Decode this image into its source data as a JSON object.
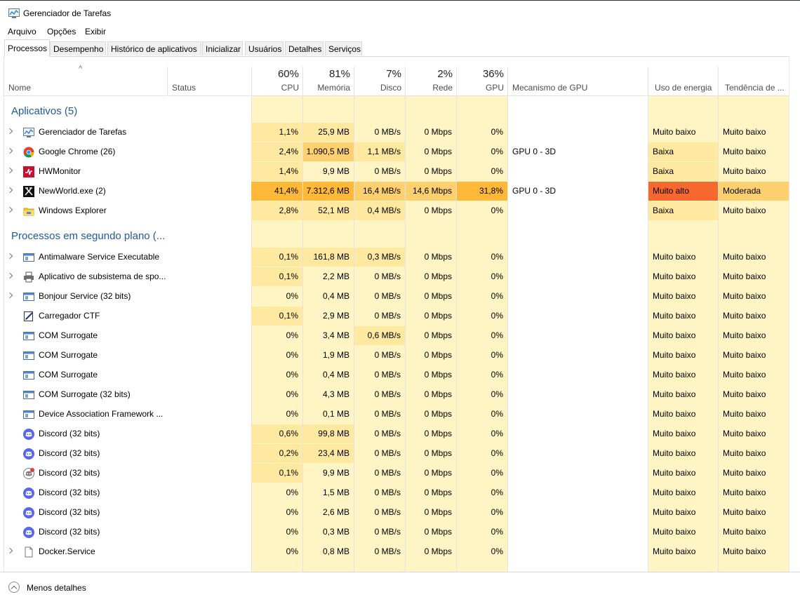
{
  "window": {
    "title": "Gerenciador de Tarefas"
  },
  "menu": [
    "Arquivo",
    "Opções",
    "Exibir"
  ],
  "tabs": [
    "Processos",
    "Desempenho",
    "Histórico de aplicativos",
    "Inicializar",
    "Usuários",
    "Detalhes",
    "Serviços"
  ],
  "active_tab": "Processos",
  "header": {
    "sort_indicator": "^",
    "name": "Nome",
    "status": "Status",
    "cpu": {
      "pct": "60%",
      "label": "CPU"
    },
    "mem": {
      "pct": "81%",
      "label": "Memória"
    },
    "disk": {
      "pct": "7%",
      "label": "Disco"
    },
    "net": {
      "pct": "2%",
      "label": "Rede"
    },
    "gpu": {
      "pct": "36%",
      "label": "GPU"
    },
    "gpu_engine": "Mecanismo de GPU",
    "power": "Uso de energia",
    "power_trend": "Tendência de ..."
  },
  "colors": {
    "light": "#fff4c4",
    "mid": "#ffe8a0",
    "strong": "#ffd070",
    "hot": "#ffb838",
    "veryhigh": "#f7682f",
    "group_text": "#1e5aa0"
  },
  "groups": {
    "apps": "Aplicativos (5)",
    "background": "Processos em segundo plano (..."
  },
  "apps": [
    {
      "name": "Gerenciador de Tarefas",
      "icon": "task-manager-icon",
      "expand": true,
      "cpu": "1,1%",
      "mem": "25,9 MB",
      "disk": "0 MB/s",
      "net": "0 Mbps",
      "gpu": "0%",
      "engine": "",
      "power": "Muito baixo",
      "trend": "Muito baixo"
    },
    {
      "name": "Google Chrome (26)",
      "icon": "chrome-icon",
      "expand": true,
      "cpu": "2,4%",
      "mem": "1.090,5 MB",
      "disk": "1,1 MB/s",
      "net": "0 Mbps",
      "gpu": "0%",
      "engine": "GPU 0 - 3D",
      "power": "Baixa",
      "trend": "Muito baixo"
    },
    {
      "name": "HWMonitor",
      "icon": "hwmonitor-icon",
      "expand": true,
      "cpu": "1,4%",
      "mem": "9,9 MB",
      "disk": "0 MB/s",
      "net": "0 Mbps",
      "gpu": "0%",
      "engine": "",
      "power": "Baixa",
      "trend": "Muito baixo"
    },
    {
      "name": "NewWorld.exe (2)",
      "icon": "newworld-icon",
      "expand": true,
      "cpu": "41,4%",
      "mem": "7.312,6 MB",
      "disk": "16,4 MB/s",
      "net": "14,6 Mbps",
      "gpu": "31,8%",
      "engine": "GPU 0 - 3D",
      "power": "Muito alto",
      "trend": "Moderada"
    },
    {
      "name": "Windows Explorer",
      "icon": "explorer-icon",
      "expand": true,
      "cpu": "2,8%",
      "mem": "52,1 MB",
      "disk": "0,4 MB/s",
      "net": "0 Mbps",
      "gpu": "0%",
      "engine": "",
      "power": "Baixa",
      "trend": "Muito baixo"
    }
  ],
  "background": [
    {
      "name": "Antimalware Service Executable",
      "icon": "service-window-icon",
      "expand": true,
      "cpu": "0,1%",
      "mem": "161,8 MB",
      "disk": "0,3 MB/s",
      "net": "0 Mbps",
      "gpu": "0%",
      "power": "Muito baixo",
      "trend": "Muito baixo"
    },
    {
      "name": "Aplicativo de subsistema de spo...",
      "icon": "printer-icon",
      "expand": true,
      "cpu": "0,1%",
      "mem": "2,2 MB",
      "disk": "0 MB/s",
      "net": "0 Mbps",
      "gpu": "0%",
      "power": "Muito baixo",
      "trend": "Muito baixo"
    },
    {
      "name": "Bonjour Service (32 bits)",
      "icon": "service-window-icon",
      "expand": true,
      "cpu": "0%",
      "mem": "0,4 MB",
      "disk": "0 MB/s",
      "net": "0 Mbps",
      "gpu": "0%",
      "power": "Muito baixo",
      "trend": "Muito baixo"
    },
    {
      "name": "Carregador CTF",
      "icon": "ctf-icon",
      "expand": false,
      "cpu": "0,1%",
      "mem": "2,9 MB",
      "disk": "0 MB/s",
      "net": "0 Mbps",
      "gpu": "0%",
      "power": "Muito baixo",
      "trend": "Muito baixo"
    },
    {
      "name": "COM Surrogate",
      "icon": "service-window-icon",
      "expand": false,
      "cpu": "0%",
      "mem": "3,4 MB",
      "disk": "0,6 MB/s",
      "net": "0 Mbps",
      "gpu": "0%",
      "power": "Muito baixo",
      "trend": "Muito baixo"
    },
    {
      "name": "COM Surrogate",
      "icon": "service-window-icon",
      "expand": false,
      "cpu": "0%",
      "mem": "1,9 MB",
      "disk": "0 MB/s",
      "net": "0 Mbps",
      "gpu": "0%",
      "power": "Muito baixo",
      "trend": "Muito baixo"
    },
    {
      "name": "COM Surrogate",
      "icon": "service-window-icon",
      "expand": false,
      "cpu": "0%",
      "mem": "0,4 MB",
      "disk": "0 MB/s",
      "net": "0 Mbps",
      "gpu": "0%",
      "power": "Muito baixo",
      "trend": "Muito baixo"
    },
    {
      "name": "COM Surrogate (32 bits)",
      "icon": "service-window-icon",
      "expand": false,
      "cpu": "0%",
      "mem": "4,3 MB",
      "disk": "0 MB/s",
      "net": "0 Mbps",
      "gpu": "0%",
      "power": "Muito baixo",
      "trend": "Muito baixo"
    },
    {
      "name": "Device Association Framework ...",
      "icon": "service-window-icon",
      "expand": false,
      "cpu": "0%",
      "mem": "0,1 MB",
      "disk": "0 MB/s",
      "net": "0 Mbps",
      "gpu": "0%",
      "power": "Muito baixo",
      "trend": "Muito baixo"
    },
    {
      "name": "Discord (32 bits)",
      "icon": "discord-icon",
      "expand": false,
      "cpu": "0,6%",
      "mem": "99,8 MB",
      "disk": "0 MB/s",
      "net": "0 Mbps",
      "gpu": "0%",
      "power": "Muito baixo",
      "trend": "Muito baixo"
    },
    {
      "name": "Discord (32 bits)",
      "icon": "discord-icon",
      "expand": false,
      "cpu": "0,2%",
      "mem": "23,4 MB",
      "disk": "0 MB/s",
      "net": "0 Mbps",
      "gpu": "0%",
      "power": "Muito baixo",
      "trend": "Muito baixo"
    },
    {
      "name": "Discord (32 bits)",
      "icon": "discord-alert-icon",
      "expand": false,
      "cpu": "0,1%",
      "mem": "9,9 MB",
      "disk": "0 MB/s",
      "net": "0 Mbps",
      "gpu": "0%",
      "power": "Muito baixo",
      "trend": "Muito baixo"
    },
    {
      "name": "Discord (32 bits)",
      "icon": "discord-icon",
      "expand": false,
      "cpu": "0%",
      "mem": "1,5 MB",
      "disk": "0 MB/s",
      "net": "0 Mbps",
      "gpu": "0%",
      "power": "Muito baixo",
      "trend": "Muito baixo"
    },
    {
      "name": "Discord (32 bits)",
      "icon": "discord-icon",
      "expand": false,
      "cpu": "0%",
      "mem": "2,6 MB",
      "disk": "0 MB/s",
      "net": "0 Mbps",
      "gpu": "0%",
      "power": "Muito baixo",
      "trend": "Muito baixo"
    },
    {
      "name": "Discord (32 bits)",
      "icon": "discord-icon",
      "expand": false,
      "cpu": "0%",
      "mem": "0,3 MB",
      "disk": "0 MB/s",
      "net": "0 Mbps",
      "gpu": "0%",
      "power": "Muito baixo",
      "trend": "Muito baixo"
    },
    {
      "name": "Docker.Service",
      "icon": "document-icon",
      "expand": true,
      "cpu": "0%",
      "mem": "0,8 MB",
      "disk": "0 MB/s",
      "net": "0 Mbps",
      "gpu": "0%",
      "power": "Muito baixo",
      "trend": "Muito baixo"
    }
  ],
  "footer": {
    "label": "Menos detalhes"
  }
}
